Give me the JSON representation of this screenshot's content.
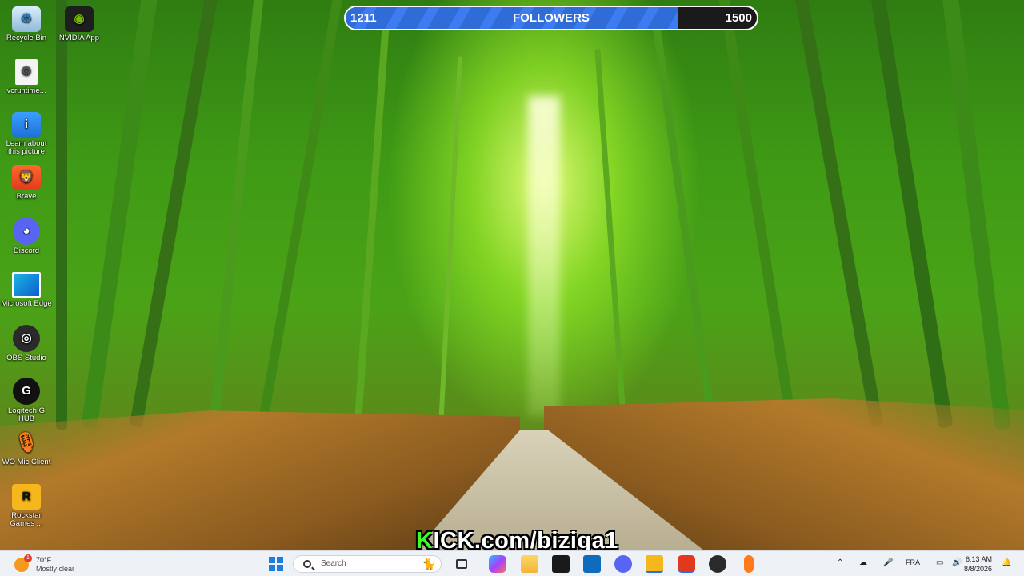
{
  "desktop": {
    "icons": [
      {
        "label": "Recycle Bin",
        "icon": "recycle-bin-icon"
      },
      {
        "label": "NVIDIA App",
        "icon": "nvidia-icon"
      },
      {
        "label": "vcruntime...",
        "icon": "file-icon"
      },
      {
        "label": "Learn about this picture",
        "icon": "info-camera-icon"
      },
      {
        "label": "Brave",
        "icon": "brave-icon"
      },
      {
        "label": "Discord",
        "icon": "discord-icon"
      },
      {
        "label": "Microsoft Edge",
        "icon": "edge-icon"
      },
      {
        "label": "OBS Studio",
        "icon": "obs-icon"
      },
      {
        "label": "Logitech G HUB",
        "icon": "logitech-icon"
      },
      {
        "label": "WO Mic Client",
        "icon": "microphone-icon"
      },
      {
        "label": "Rockstar Games ...",
        "icon": "rockstar-icon"
      }
    ]
  },
  "followers": {
    "current": "1211",
    "label": "FOLLOWERS",
    "goal": "1500",
    "progress": 0.81
  },
  "watermark": {
    "k": "K",
    "rest": "ICK.com/biziga1"
  },
  "taskbar": {
    "weather_temp": "70°F",
    "weather_condition": "Mostly clear",
    "weather_badge": "1",
    "search_placeholder": "Search",
    "language": "FRA",
    "time": "6:13 AM",
    "date": "8/8/2026",
    "apps": [
      "start-icon",
      "search-icon",
      "task-view-icon",
      "copilot-icon",
      "file-explorer-icon",
      "store-icon",
      "outlook-icon",
      "discord-icon",
      "rockstar-icon",
      "brave-icon",
      "obs-icon",
      "microphone-icon"
    ],
    "colors": {
      "accent": "#2f6cd8",
      "kick_green": "#3dff25"
    }
  }
}
